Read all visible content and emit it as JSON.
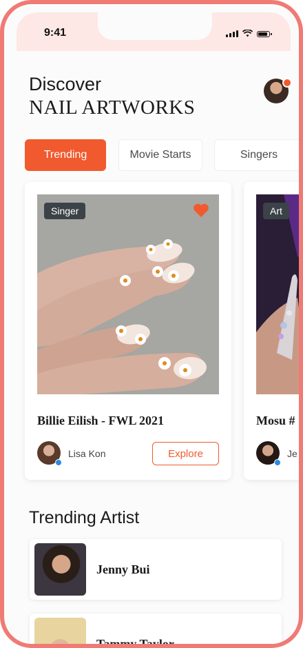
{
  "status_bar": {
    "time": "9:41",
    "icons": [
      "signal-icon",
      "wifi-icon",
      "battery-icon"
    ]
  },
  "header": {
    "greeting": "Discover",
    "title": "NAIL ARTWORKS",
    "avatar": "user-avatar",
    "notification_color": "#f15a2e"
  },
  "tabs": [
    {
      "label": "Trending",
      "active": true
    },
    {
      "label": "Movie Starts",
      "active": false
    },
    {
      "label": "Singers",
      "active": false
    }
  ],
  "cards": [
    {
      "badge": "Singer",
      "title": "Billie Eilish - FWL 2021",
      "author": "Lisa Kon",
      "action_label": "Explore",
      "favorite_icon": "heart-icon"
    },
    {
      "badge": "Art",
      "title": "Mosu #",
      "author": "Je"
    }
  ],
  "trending_artists": {
    "heading": "Trending Artist",
    "items": [
      {
        "name": "Jenny Bui"
      },
      {
        "name": "Tammy Taylor"
      }
    ]
  },
  "colors": {
    "accent": "#f15a2e",
    "frame": "#f07a74",
    "badge_bg": "#3b4248",
    "status_bar_bg": "#fde8e5"
  }
}
